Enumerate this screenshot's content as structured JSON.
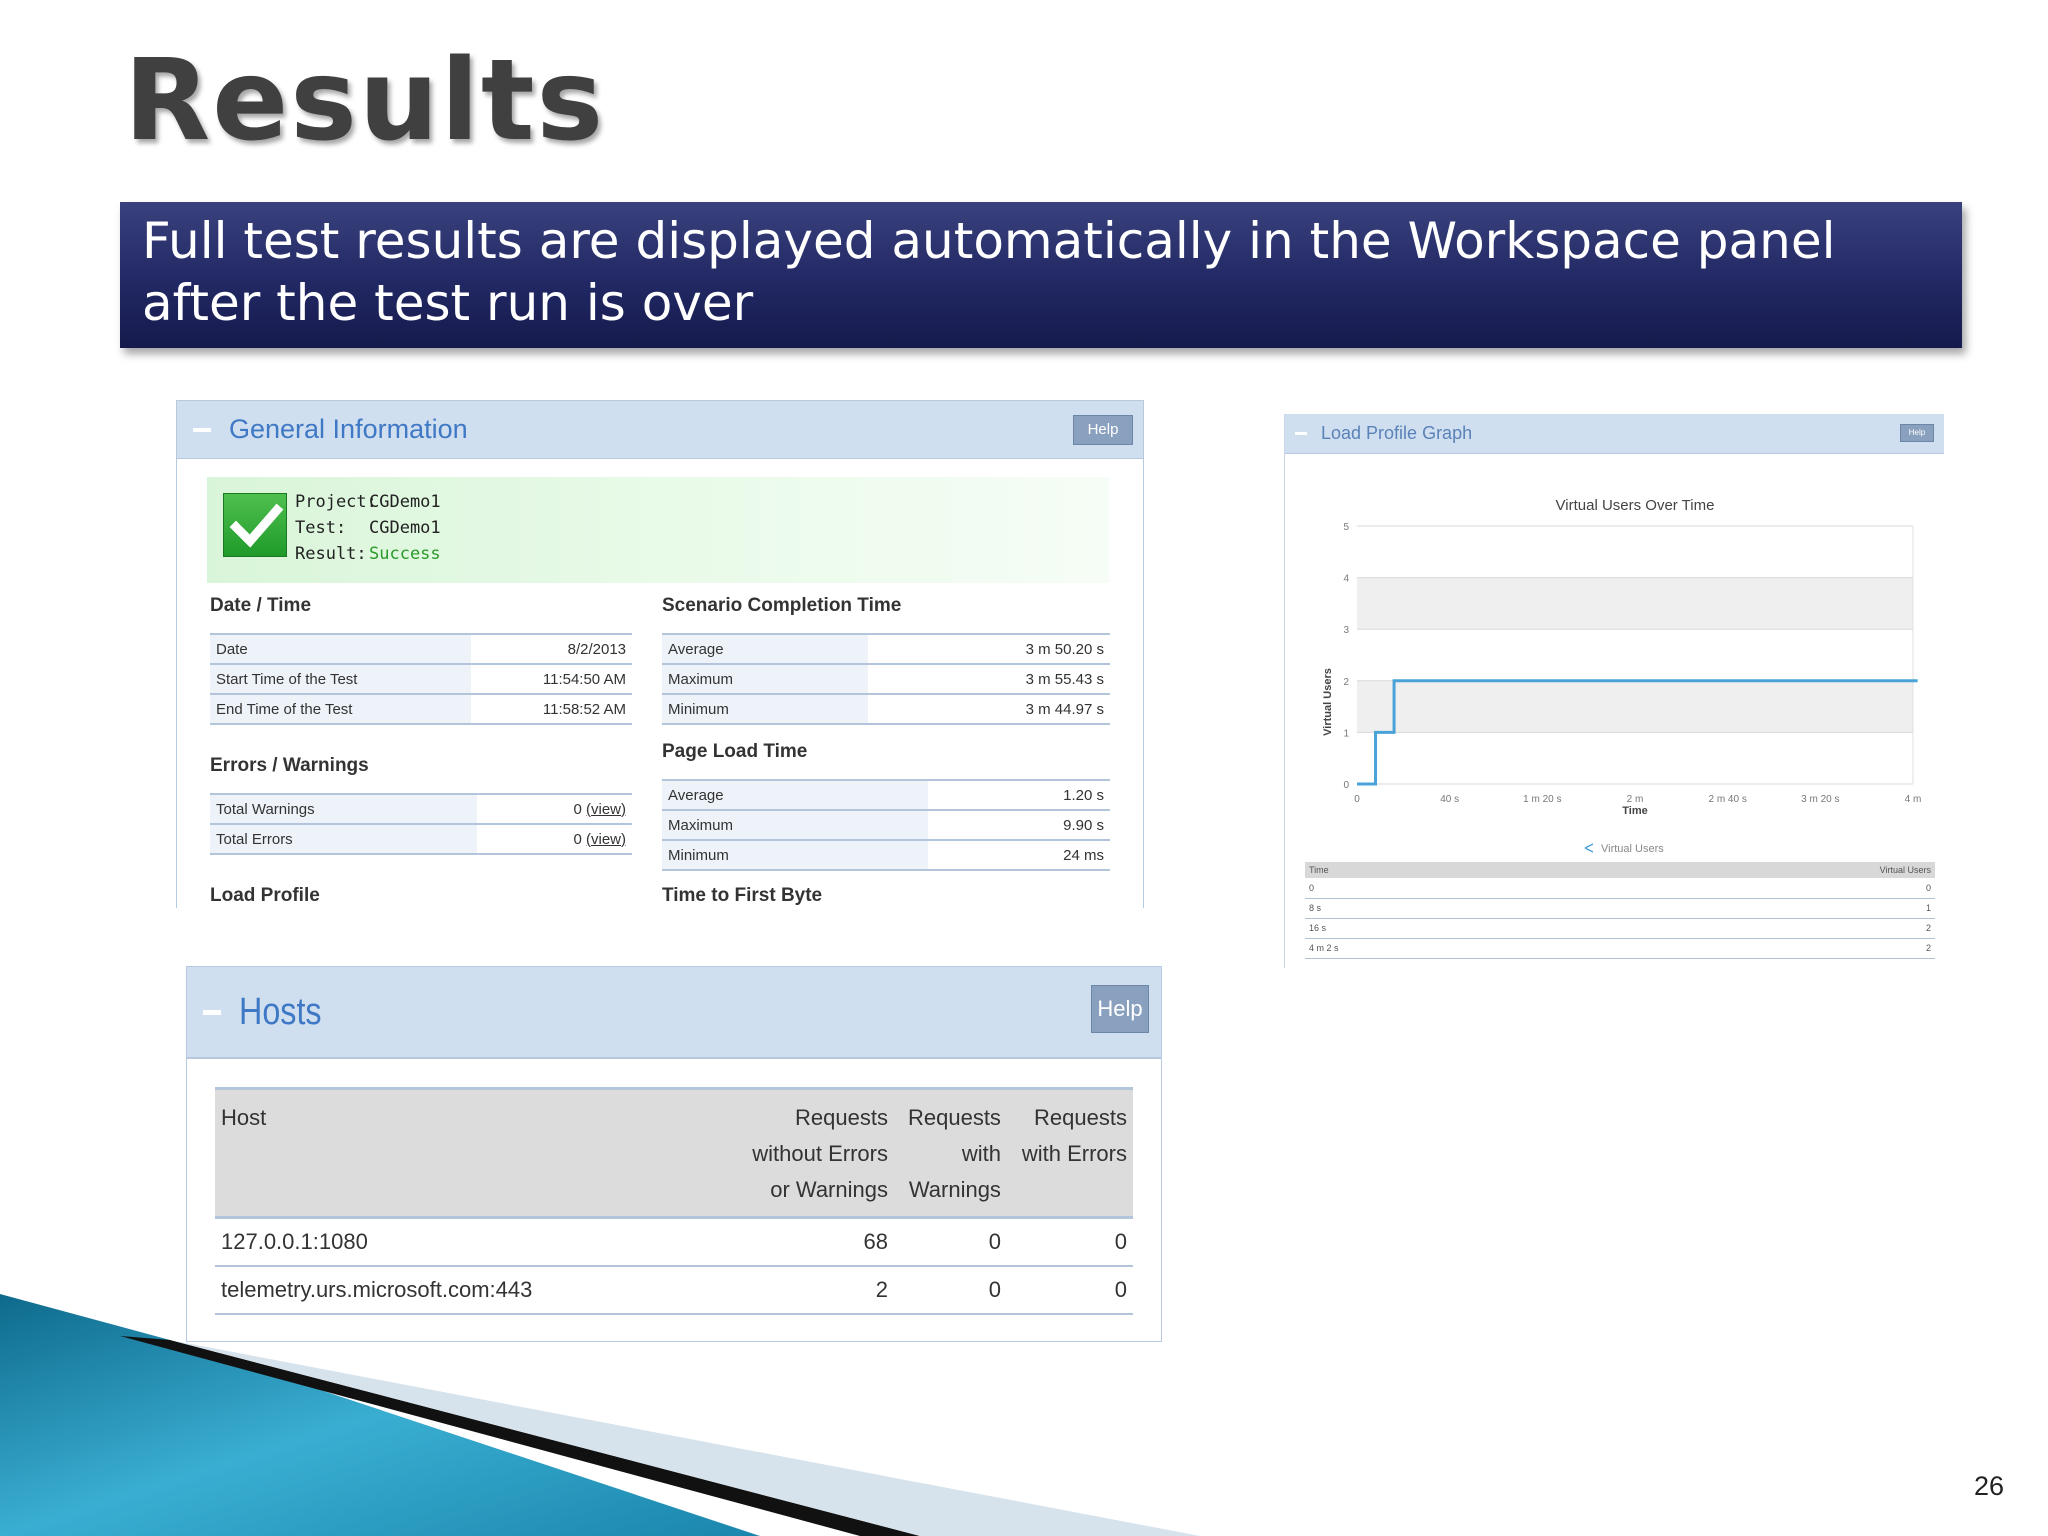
{
  "slide": {
    "title": "Results",
    "banner_line1": "Full test results are displayed automatically in the Workspace panel",
    "banner_line2": "after the test run is over",
    "page_number": "26"
  },
  "general_info": {
    "title": "General Information",
    "help_label": "Help",
    "project_key": "Project:",
    "project_value": "CGDemo1",
    "test_key": "Test:",
    "test_value": "CGDemo1",
    "result_key": "Result:",
    "result_value": "Success",
    "result_icon": "checkmark-icon",
    "date_time": {
      "title": "Date / Time",
      "rows": [
        {
          "label": "Date",
          "value": "8/2/2013"
        },
        {
          "label": "Start Time of the Test",
          "value": "11:54:50 AM"
        },
        {
          "label": "End Time of the Test",
          "value": "11:58:52 AM"
        }
      ]
    },
    "errors_warnings": {
      "title": "Errors / Warnings",
      "rows": [
        {
          "label": "Total Warnings",
          "value": "0",
          "link": "(view)"
        },
        {
          "label": "Total Errors",
          "value": "0",
          "link": "(view)"
        }
      ]
    },
    "load_profile_title": "Load Profile",
    "scenario_completion": {
      "title": "Scenario Completion Time",
      "rows": [
        {
          "label": "Average",
          "value": "3 m 50.20 s"
        },
        {
          "label": "Maximum",
          "value": "3 m 55.43 s"
        },
        {
          "label": "Minimum",
          "value": "3 m 44.97 s"
        }
      ]
    },
    "page_load": {
      "title": "Page Load Time",
      "rows": [
        {
          "label": "Average",
          "value": "1.20 s"
        },
        {
          "label": "Maximum",
          "value": "9.90 s"
        },
        {
          "label": "Minimum",
          "value": "24 ms"
        }
      ]
    },
    "ttfb_title": "Time to First Byte"
  },
  "load_profile_graph": {
    "title": "Load Profile Graph",
    "help_label": "Help",
    "table_headers": [
      "Time",
      "Virtual Users"
    ],
    "table_rows": [
      [
        "0",
        "0"
      ],
      [
        "8 s",
        "1"
      ],
      [
        "16 s",
        "2"
      ],
      [
        "4 m 2 s",
        "2"
      ]
    ]
  },
  "chart_data": {
    "type": "line",
    "title": "Virtual Users Over Time",
    "xlabel": "Time",
    "ylabel": "Virtual Users",
    "x_ticks": [
      "0",
      "40 s",
      "1 m 20 s",
      "2 m",
      "2 m 40 s",
      "3 m 20 s",
      "4 m"
    ],
    "y_ticks": [
      "0",
      "1",
      "2",
      "3",
      "4",
      "5"
    ],
    "xlim": [
      0,
      240
    ],
    "ylim": [
      0,
      5
    ],
    "grid": true,
    "legend": "bottom",
    "series": [
      {
        "name": "Virtual Users",
        "color": "#4aa3d8",
        "step": true,
        "x": [
          0,
          8,
          8,
          16,
          16,
          242
        ],
        "y": [
          0,
          0,
          1,
          1,
          2,
          2
        ]
      }
    ]
  },
  "hosts": {
    "title": "Hosts",
    "help_label": "Help",
    "headers": {
      "host": "Host",
      "col1": [
        "Requests",
        "without Errors",
        "or Warnings"
      ],
      "col2": [
        "Requests",
        "with",
        "Warnings"
      ],
      "col3": [
        "Requests",
        "with Errors"
      ]
    },
    "rows": [
      {
        "host": "127.0.0.1:1080",
        "ok": "68",
        "warnings": "0",
        "errors": "0"
      },
      {
        "host": "telemetry.urs.microsoft.com:443",
        "ok": "2",
        "warnings": "0",
        "errors": "0"
      }
    ]
  },
  "colors": {
    "banner": "#232a66",
    "panel_header": "#d0dff0",
    "panel_title": "#3f78c4",
    "success_green": "#2a9a2a",
    "chart_line": "#4aa3d8"
  }
}
